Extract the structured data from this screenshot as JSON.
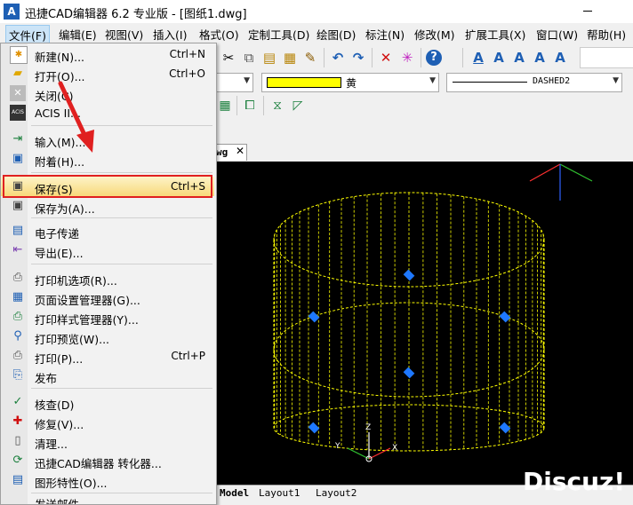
{
  "window": {
    "app_logo": "A",
    "title": "迅捷CAD编辑器 6.2 专业版  - [图纸1.dwg]"
  },
  "menubar": {
    "items": [
      "文件(F)",
      "编辑(E)",
      "视图(V)",
      "插入(I)",
      "格式(O)",
      "定制工具(D)",
      "绘图(D)",
      "标注(N)",
      "修改(M)",
      "扩展工具(X)",
      "窗口(W)",
      "帮助(H)"
    ]
  },
  "properties": {
    "color_name": "黄",
    "linetype_name": "DASHED2",
    "color_swatch": "#ffff00"
  },
  "doc_tab": {
    "label": "wg",
    "close": "✕"
  },
  "layout_tabs": [
    "Model",
    "Layout1",
    "Layout2"
  ],
  "watermark": "Discuz!",
  "file_menu": {
    "items": [
      {
        "icon": "new-file-icon",
        "label": "新建(N)...",
        "shortcut": "Ctrl+N"
      },
      {
        "icon": "open-folder-icon",
        "label": "打开(O)...",
        "shortcut": "Ctrl+O"
      },
      {
        "icon": "close-icon",
        "label": "关闭(C)",
        "shortcut": ""
      },
      {
        "icon": "acis-icon",
        "label": "ACIS II...",
        "shortcut": ""
      },
      {
        "icon": "import-icon",
        "label": "输入(M)...",
        "shortcut": ""
      },
      {
        "icon": "attach-icon",
        "label": "附着(H)...",
        "shortcut": ""
      },
      {
        "icon": "save-icon",
        "label": "保存(S)",
        "shortcut": "Ctrl+S"
      },
      {
        "icon": "save-as-icon",
        "label": "保存为(A)...",
        "shortcut": ""
      },
      {
        "icon": "etransmit-icon",
        "label": "电子传递",
        "shortcut": ""
      },
      {
        "icon": "export-icon",
        "label": "导出(E)...",
        "shortcut": ""
      },
      {
        "icon": "printer-options-icon",
        "label": "打印机选项(R)...",
        "shortcut": ""
      },
      {
        "icon": "page-setup-icon",
        "label": "页面设置管理器(G)...",
        "shortcut": ""
      },
      {
        "icon": "print-style-icon",
        "label": "打印样式管理器(Y)...",
        "shortcut": ""
      },
      {
        "icon": "print-preview-icon",
        "label": "打印预览(W)...",
        "shortcut": ""
      },
      {
        "icon": "print-icon",
        "label": "打印(P)...",
        "shortcut": "Ctrl+P"
      },
      {
        "icon": "publish-icon",
        "label": "发布",
        "shortcut": ""
      },
      {
        "icon": "audit-icon",
        "label": "核查(D)",
        "shortcut": ""
      },
      {
        "icon": "recover-icon",
        "label": "修复(V)...",
        "shortcut": ""
      },
      {
        "icon": "purge-icon",
        "label": "清理...",
        "shortcut": ""
      },
      {
        "icon": "converter-icon",
        "label": "迅捷CAD编辑器 转化器...",
        "shortcut": ""
      },
      {
        "icon": "drawing-properties-icon",
        "label": "图形特性(O)...",
        "shortcut": ""
      },
      {
        "icon": "send-mail-icon",
        "label": "发送邮件",
        "shortcut": ""
      }
    ]
  },
  "axis_labels": {
    "x": "X",
    "y": "Y",
    "z": "Z"
  },
  "colors": {
    "highlight_border": "#e02020",
    "grip": "#1e78ff",
    "drawing": "#ffff00",
    "canvas": "#000000"
  }
}
